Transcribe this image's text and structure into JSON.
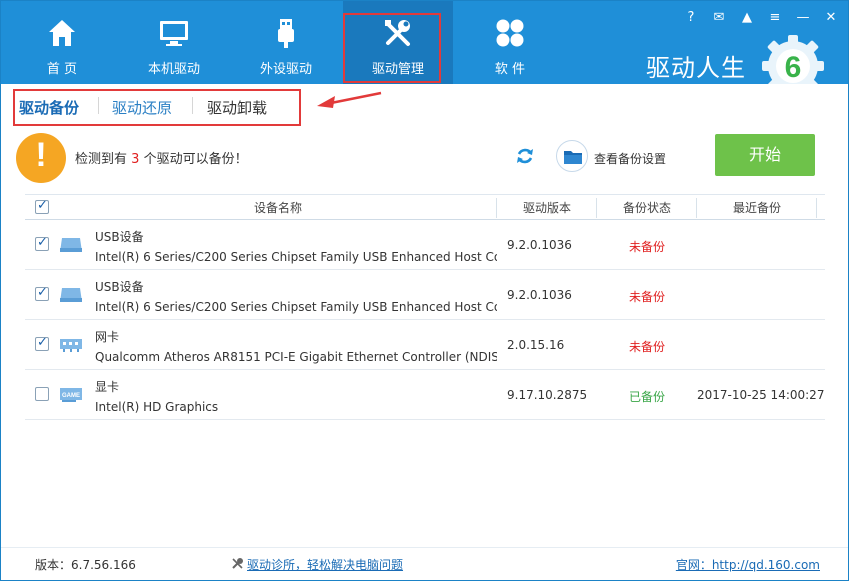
{
  "nav": {
    "items": [
      {
        "label": "首 页",
        "icon": "home-icon"
      },
      {
        "label": "本机驱动",
        "icon": "monitor-icon"
      },
      {
        "label": "外设驱动",
        "icon": "usb-icon"
      },
      {
        "label": "驱动管理",
        "icon": "tools-icon"
      },
      {
        "label": "软 件",
        "icon": "apps-icon"
      }
    ],
    "active_index": 3
  },
  "window_controls": [
    "?",
    "✉",
    "▲",
    "≡",
    "—",
    "✕"
  ],
  "brand": {
    "name": "驱动人生",
    "logo_digit": "6"
  },
  "subtabs": [
    {
      "label": "驱动备份",
      "active": true
    },
    {
      "label": "驱动还原",
      "active": false
    },
    {
      "label": "驱动卸载",
      "active": false
    }
  ],
  "info": {
    "prefix": "检测到有",
    "count": "3",
    "suffix": "个驱动可以备份！",
    "settings_label": "查看备份设置",
    "start_label": "开始"
  },
  "table": {
    "columns": [
      "设备名称",
      "驱动版本",
      "备份状态",
      "最近备份"
    ],
    "header_checked": true,
    "rows": [
      {
        "checked": true,
        "icon": "usb-device-icon",
        "category": "USB设备",
        "name": "Intel(R) 6 Series/C200 Series Chipset Family USB Enhanced Host Co...",
        "version": "9.2.0.1036",
        "status": "未备份",
        "status_color": "#e02020",
        "recent": ""
      },
      {
        "checked": true,
        "icon": "usb-device-icon",
        "category": "USB设备",
        "name": "Intel(R) 6 Series/C200 Series Chipset Family USB Enhanced Host Co...",
        "version": "9.2.0.1036",
        "status": "未备份",
        "status_color": "#e02020",
        "recent": ""
      },
      {
        "checked": true,
        "icon": "network-card-icon",
        "category": "网卡",
        "name": "Qualcomm Atheros AR8151 PCI-E Gigabit Ethernet Controller (NDIS...",
        "version": "2.0.15.16",
        "status": "未备份",
        "status_color": "#e02020",
        "recent": ""
      },
      {
        "checked": false,
        "icon": "graphics-card-icon",
        "category": "显卡",
        "name": "Intel(R) HD Graphics",
        "version": "9.17.10.2875",
        "status": "已备份",
        "status_color": "#3aa648",
        "recent": "2017-10-25 14:00:27"
      }
    ]
  },
  "footer": {
    "version": "版本：6.7.56.166",
    "diagnose": "驱动诊所，轻松解决电脑问题",
    "website": "官网：http://qd.160.com"
  },
  "colors": {
    "header": "#1f8fd8",
    "accent_green": "#6ec24a",
    "highlight_red": "#e23a3a"
  }
}
